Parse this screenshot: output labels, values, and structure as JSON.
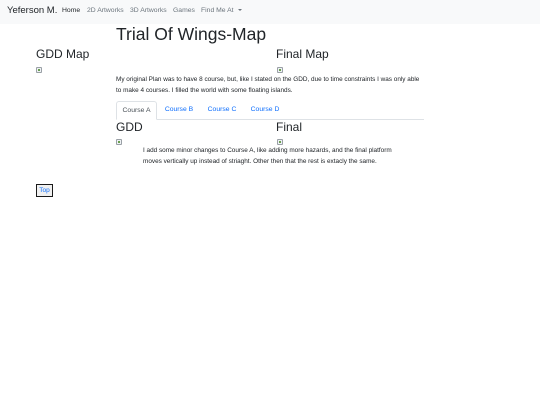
{
  "navbar": {
    "brand": "Yeferson M.",
    "items": [
      {
        "label": "Home",
        "active": true
      },
      {
        "label": "2D Artworks",
        "active": false
      },
      {
        "label": "3D Artworks",
        "active": false
      },
      {
        "label": "Games",
        "active": false
      },
      {
        "label": "Find Me At",
        "active": false,
        "dropdown": true
      }
    ]
  },
  "page": {
    "title": "Trial Of Wings-Map",
    "gdd_map_heading": "GDD Map",
    "final_map_heading": "Final Map",
    "intro_text": "My original Plan was to have 8 course, but, like I stated on the GDD, due to time constraints I was only able to make 4 courses. I filled the world with some floating islands."
  },
  "tabs": [
    {
      "label": "Course A",
      "active": true
    },
    {
      "label": "Course B",
      "active": false
    },
    {
      "label": "Course C",
      "active": false
    },
    {
      "label": "Course D",
      "active": false
    }
  ],
  "course_panel": {
    "gdd_heading": "GDD",
    "final_heading": "Final",
    "description": "I add some minor changes to Course A, like adding more hazards, and the final platform moves vertically up instead of striaght. Other then that the rest is extacly the same."
  },
  "top_button": {
    "label": "Top"
  },
  "colors": {
    "navbar_bg": "#f8f9fa",
    "link": "#0d6efd",
    "text": "#212529",
    "muted": "#6c757d"
  }
}
